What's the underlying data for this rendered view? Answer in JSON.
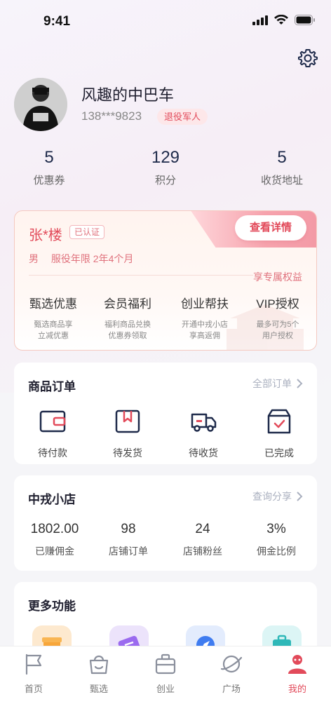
{
  "status_bar": {
    "time": "9:41"
  },
  "profile": {
    "name": "风趣的中巴车",
    "phone": "138***9823",
    "badge": "退役军人"
  },
  "stats": [
    {
      "value": "5",
      "label": "优惠券"
    },
    {
      "value": "129",
      "label": "积分"
    },
    {
      "value": "5",
      "label": "收货地址"
    }
  ],
  "veteran_card": {
    "name": "张*楼",
    "verified": "已认证",
    "gender": "男",
    "service_years": "服役年限 2年4个月",
    "detail_button": "查看详情",
    "exclusive_label": "享专属权益",
    "benefits": [
      {
        "title": "甄选优惠",
        "desc_line1": "甄选商品享",
        "desc_line2": "立减优惠"
      },
      {
        "title": "会员福利",
        "desc_line1": "福利商品兑换",
        "desc_line2": "优惠券领取"
      },
      {
        "title": "创业帮扶",
        "desc_line1": "开通中戎小店",
        "desc_line2": "享高返佣"
      },
      {
        "title": "VIP授权",
        "desc_line1": "最多可为5个",
        "desc_line2": "用户授权"
      }
    ]
  },
  "orders": {
    "title": "商品订单",
    "link": "全部订单",
    "items": [
      {
        "label": "待付款",
        "icon": "wallet-icon"
      },
      {
        "label": "待发货",
        "icon": "package-icon"
      },
      {
        "label": "待收货",
        "icon": "truck-icon"
      },
      {
        "label": "已完成",
        "icon": "box-check-icon"
      }
    ]
  },
  "shop": {
    "title": "中戎小店",
    "link": "查询分享",
    "stats": [
      {
        "value": "1802.00",
        "label": "已赚佣金"
      },
      {
        "value": "98",
        "label": "店铺订单"
      },
      {
        "value": "24",
        "label": "店铺粉丝"
      },
      {
        "value": "3%",
        "label": "佣金比例"
      }
    ]
  },
  "more": {
    "title": "更多功能",
    "icons": [
      {
        "icon": "gift-icon",
        "color": "#fde9cf"
      },
      {
        "icon": "coupon-icon",
        "color": "#ece3fb"
      },
      {
        "icon": "compass-icon",
        "color": "#e3ecfd"
      },
      {
        "icon": "briefcase-icon",
        "color": "#dcf5f5"
      }
    ]
  },
  "tabbar": [
    {
      "label": "首页",
      "icon": "flag-icon",
      "active": false
    },
    {
      "label": "甄选",
      "icon": "basket-icon",
      "active": false
    },
    {
      "label": "创业",
      "icon": "briefcase-icon",
      "active": false
    },
    {
      "label": "广场",
      "icon": "planet-icon",
      "active": false
    },
    {
      "label": "我的",
      "icon": "user-icon",
      "active": true
    }
  ],
  "colors": {
    "accent": "#e24a5a",
    "navy": "#1e2a4a"
  }
}
